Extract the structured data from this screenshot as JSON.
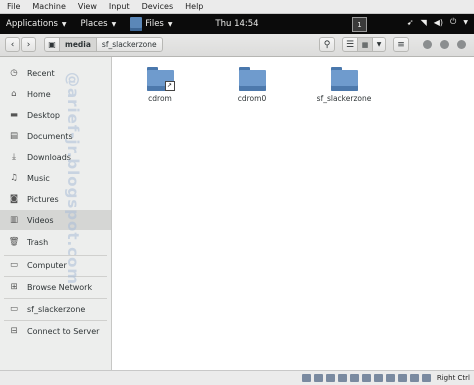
{
  "host_menu": [
    "File",
    "Machine",
    "View",
    "Input",
    "Devices",
    "Help"
  ],
  "topbar": {
    "applications": "Applications",
    "places": "Places",
    "files": "Files",
    "clock": "Thu 14:54",
    "workspace": "1"
  },
  "pathbar": [
    "media",
    "sf_slackerzone"
  ],
  "sidebar": {
    "items": [
      {
        "label": "Recent",
        "icon": "clock-icon"
      },
      {
        "label": "Home",
        "icon": "home-icon"
      },
      {
        "label": "Desktop",
        "icon": "folder-icon"
      },
      {
        "label": "Documents",
        "icon": "folder-icon"
      },
      {
        "label": "Downloads",
        "icon": "download-icon"
      },
      {
        "label": "Music",
        "icon": "music-icon"
      },
      {
        "label": "Pictures",
        "icon": "camera-icon"
      },
      {
        "label": "Videos",
        "icon": "film-icon"
      },
      {
        "label": "Trash",
        "icon": "trash-icon"
      },
      {
        "label": "Computer",
        "icon": "drive-icon"
      },
      {
        "label": "Browse Network",
        "icon": "network-icon"
      },
      {
        "label": "sf_slackerzone",
        "icon": "drive-icon"
      },
      {
        "label": "Connect to Server",
        "icon": "server-icon"
      }
    ],
    "selected": "Videos",
    "watermark": "@arief-jr.blogspot.com"
  },
  "files": [
    {
      "name": "cdrom",
      "link": true
    },
    {
      "name": "cdrom0",
      "link": false
    },
    {
      "name": "sf_slackerzone",
      "link": false
    }
  ],
  "status_bar": {
    "host_key": "Right Ctrl"
  },
  "colors": {
    "topbar": "#0b0b0b",
    "folder": "#6f9bcd",
    "sidebar": "#edeeed"
  }
}
